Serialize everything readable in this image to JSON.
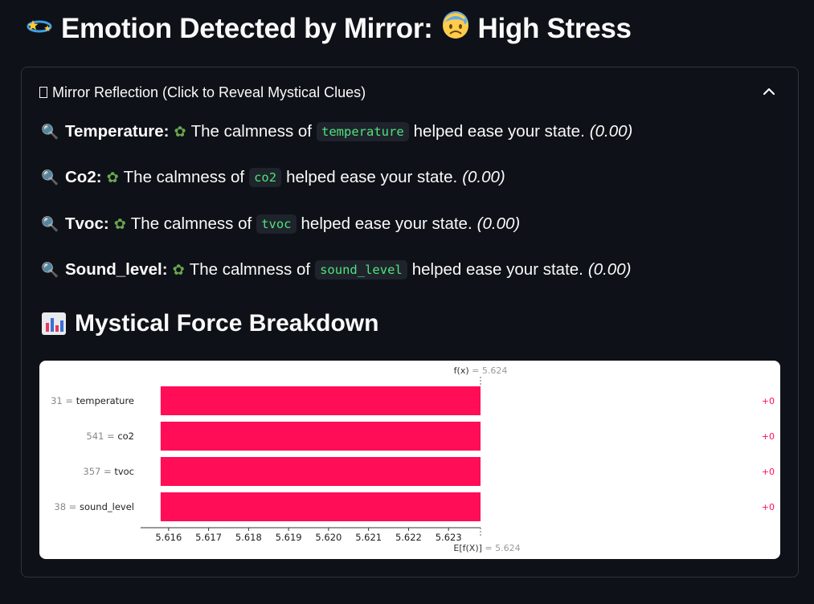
{
  "title": {
    "prefix_icon": "dizzy-star-icon",
    "text": "Emotion Detected by Mirror:",
    "emotion_icon": "anxious-sweat-face-icon",
    "emotion": "High Stress"
  },
  "expander": {
    "label": "Mirror Reflection (Click to Reveal Mystical Clues)",
    "expanded": true,
    "clues": [
      {
        "feature": "Temperature",
        "code": "temperature",
        "before": "The calmness of",
        "after": "helped ease your state.",
        "value": "(0.00)"
      },
      {
        "feature": "Co2",
        "code": "co2",
        "before": "The calmness of",
        "after": "helped ease your state.",
        "value": "(0.00)"
      },
      {
        "feature": "Tvoc",
        "code": "tvoc",
        "before": "The calmness of",
        "after": "helped ease your state.",
        "value": "(0.00)"
      },
      {
        "feature": "Sound_level",
        "code": "sound_level",
        "before": "The calmness of",
        "after": "helped ease your state.",
        "value": "(0.00)"
      }
    ]
  },
  "breakdown": {
    "heading": "Mystical Force Breakdown",
    "heading_icon": "bar-chart-icon"
  },
  "chart_data": {
    "type": "bar",
    "orientation": "horizontal",
    "categories": [
      "temperature",
      "co2",
      "tvoc",
      "sound_level"
    ],
    "feature_values": [
      "31",
      "541",
      "357",
      "38"
    ],
    "contributions": [
      0,
      0,
      0,
      0
    ],
    "contribution_labels": [
      "+0",
      "+0",
      "+0",
      "+0"
    ],
    "bar_start": 5.6158,
    "bar_end": 5.6238,
    "xlim": [
      5.6153,
      5.6238
    ],
    "xticks": [
      "5.616",
      "5.617",
      "5.618",
      "5.619",
      "5.620",
      "5.621",
      "5.622",
      "5.623"
    ],
    "fx_label": "f(x)",
    "fx_value": "= 5.624",
    "efx_label": "E[f(X)]",
    "efx_value": "= 5.624",
    "bar_color": "#ff0d57",
    "grid": false
  }
}
